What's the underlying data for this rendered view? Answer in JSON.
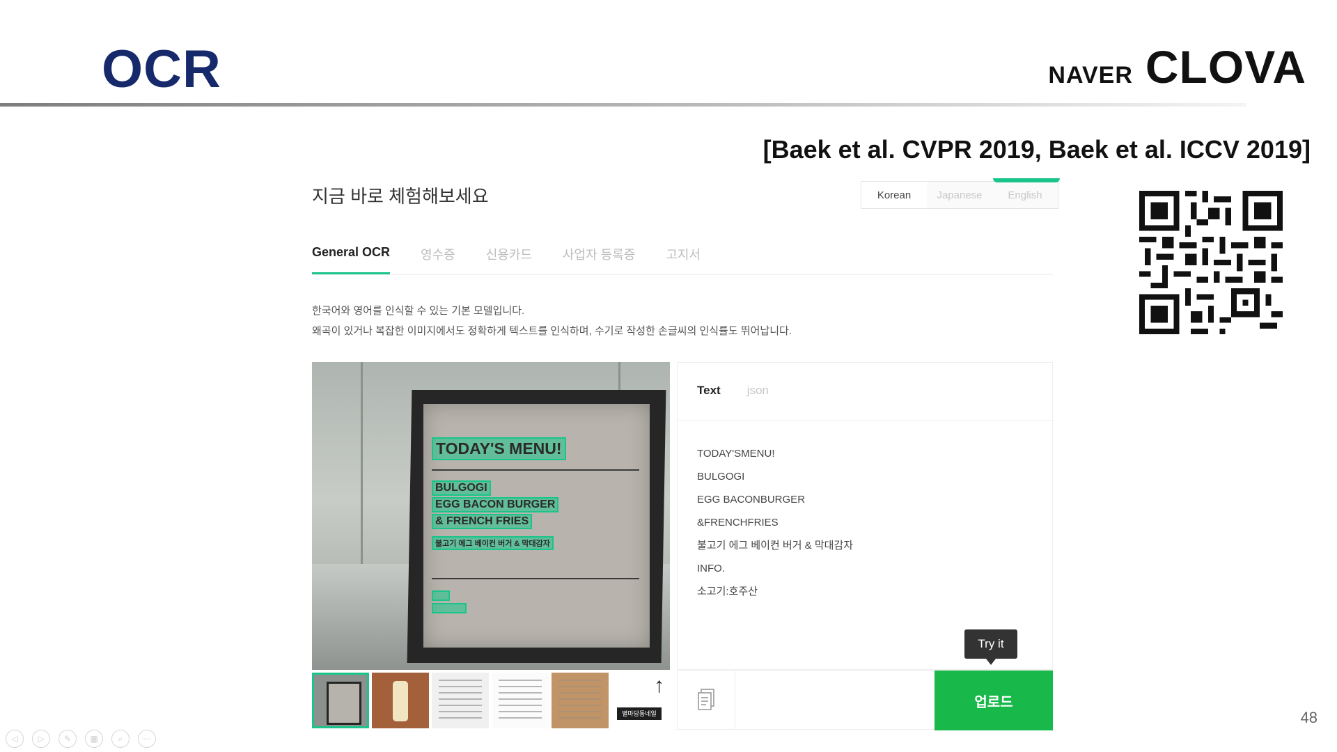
{
  "slide": {
    "title": "OCR",
    "logo": {
      "brand": "NAVER",
      "product": "CLOVA"
    },
    "citation": "[Baek et al. CVPR 2019, Baek et al. ICCV 2019]",
    "page_number": "48"
  },
  "demo": {
    "heading": "지금 바로 체험해보세요",
    "languages": [
      {
        "label": "Korean",
        "active": true
      },
      {
        "label": "Japanese",
        "active": false
      },
      {
        "label": "English",
        "active": false
      }
    ],
    "tabs": [
      {
        "label": "General OCR",
        "active": true
      },
      {
        "label": "영수증",
        "active": false
      },
      {
        "label": "신용카드",
        "active": false
      },
      {
        "label": "사업자 등록증",
        "active": false
      },
      {
        "label": "고지서",
        "active": false
      }
    ],
    "description": [
      "한국어와 영어를 인식할 수 있는 기본 모델입니다.",
      "왜곡이 있거나 복잡한 이미지에서도 정확하게 텍스트를 인식하며, 수기로 작성한 손글씨의 인식률도 뛰어납니다."
    ],
    "image_sign": {
      "title": "TODAY'S MENU!",
      "lines": [
        "BULGOGI",
        "EGG BACON BURGER",
        "& FRENCH FRIES",
        "불고기 에그 베이컨 버거 & 막대감자"
      ]
    },
    "result_tabs": [
      {
        "label": "Text",
        "active": true
      },
      {
        "label": "json",
        "active": false
      }
    ],
    "ocr_lines": [
      "TODAY'SMENU!",
      "BULGOGI",
      "EGG BACONBURGER",
      "&FRENCHFRIES",
      "불고기 에그 베이컨 버거 & 막대감자",
      "INFO.",
      "소고기:호주산"
    ],
    "tooltip": "Try it",
    "upload_label": "업로드",
    "thumb6_text": "별마당동네일"
  },
  "colors": {
    "accent_green": "#19c58a",
    "upload_green": "#19b84a",
    "title_navy": "#16296b"
  },
  "icons": {
    "copy": "copy-document-icon",
    "upload_arrow": "arrow-up-icon",
    "qr": "qr-code-icon"
  }
}
